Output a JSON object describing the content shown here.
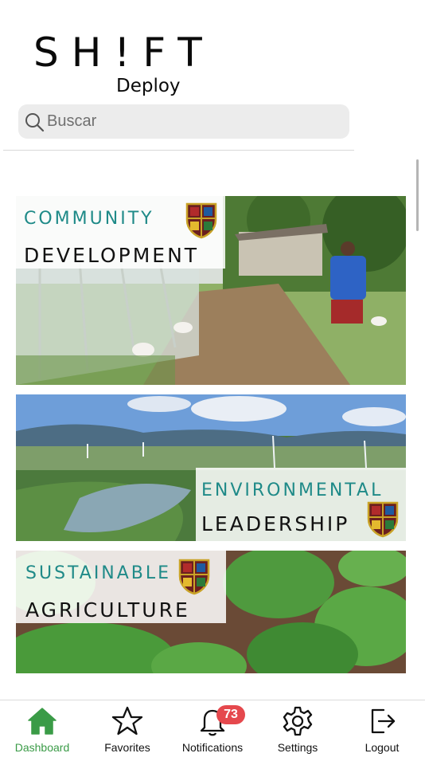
{
  "brand": {
    "wordmark": "SH!FT",
    "subtitle": "Deploy"
  },
  "search": {
    "placeholder": "Buscar"
  },
  "cards": [
    {
      "line1": "COMMUNITY",
      "line2": "DEVELOPMENT",
      "theme": "community"
    },
    {
      "line1": "ENVIRONMENTAL",
      "line2": "LEADERSHIP",
      "theme": "environment"
    },
    {
      "line1": "SUSTAINABLE",
      "line2": "AGRICULTURE",
      "theme": "agriculture"
    }
  ],
  "tabbar": {
    "items": [
      {
        "label": "Dashboard",
        "icon": "home-icon",
        "active": true
      },
      {
        "label": "Favorites",
        "icon": "star-icon"
      },
      {
        "label": "Notifications",
        "icon": "bell-icon",
        "badge": "73"
      },
      {
        "label": "Settings",
        "icon": "gear-icon"
      },
      {
        "label": "Logout",
        "icon": "logout-icon"
      }
    ]
  },
  "colors": {
    "active_tab": "#3a9b47",
    "badge": "#e5484d",
    "teal_text": "#1f8a88",
    "search_bg": "#ececec"
  }
}
